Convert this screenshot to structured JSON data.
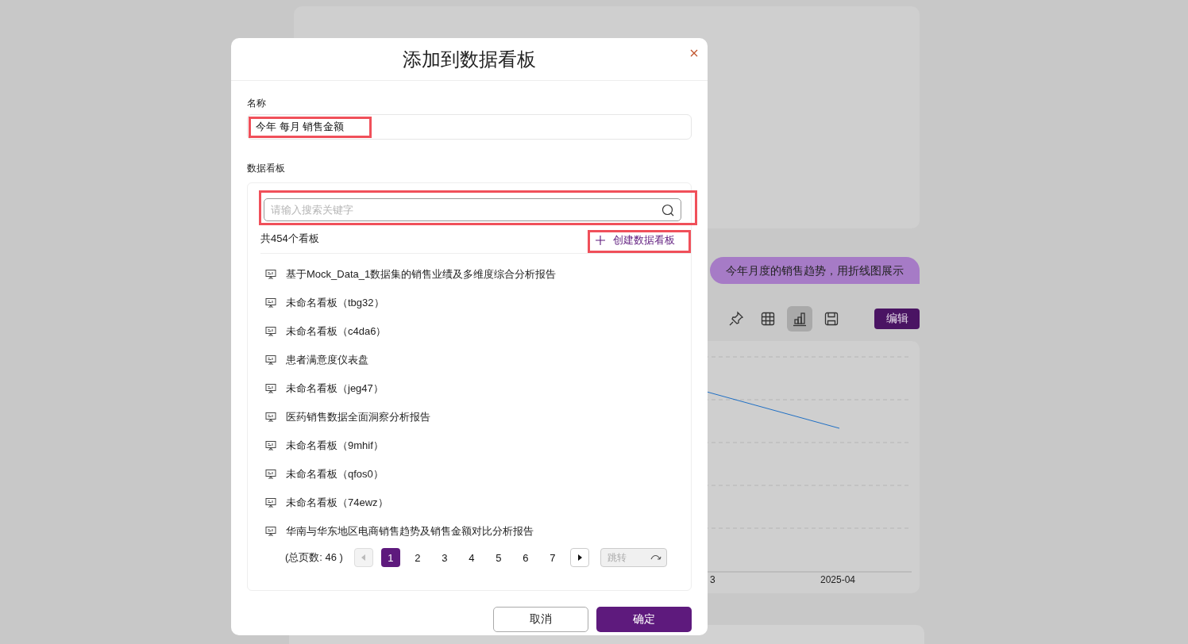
{
  "background": {
    "chat_bubble": "今年月度的销售趋势，用折线图展示",
    "toolbar": [
      {
        "kind": "pin",
        "selected": false
      },
      {
        "kind": "table",
        "selected": false
      },
      {
        "kind": "chart",
        "selected": true
      },
      {
        "kind": "save",
        "selected": false
      }
    ],
    "edit_button": "编辑",
    "chart_axis_labels": [
      "3",
      "2025-04"
    ]
  },
  "dialog": {
    "title": "添加到数据看板",
    "name_field": {
      "label": "名称",
      "value": "今年 每月 销售金额"
    },
    "dashboard": {
      "label": "数据看板",
      "search": {
        "placeholder": "请输入搜索关键字"
      },
      "count": "共454个看板",
      "create_button": "创建数据看板",
      "items": [
        "基于Mock_Data_1数据集的销售业绩及多维度综合分析报告",
        "未命名看板（tbg32）",
        "未命名看板（c4da6）",
        "患者满意度仪表盘",
        "未命名看板（jeg47）",
        "医药销售数据全面洞察分析报告",
        "未命名看板（9mhif）",
        "未命名看板（qfos0）",
        "未命名看板（74ewz）",
        "华南与华东地区电商销售趋势及销售金额对比分析报告"
      ],
      "pagination": {
        "total": "(总页数: 46 )",
        "prev": {
          "disabled": true
        },
        "pages": [
          {
            "label": "1",
            "selected": true
          },
          {
            "label": "2",
            "selected": false
          },
          {
            "label": "3",
            "selected": false
          },
          {
            "label": "4",
            "selected": false
          },
          {
            "label": "5",
            "selected": false
          },
          {
            "label": "6",
            "selected": false
          },
          {
            "label": "7",
            "selected": false
          }
        ],
        "next": {
          "disabled": false
        },
        "jump": {
          "placeholder": "跳转"
        }
      }
    },
    "buttons": {
      "cancel": "取消",
      "ok": "确定"
    }
  }
}
